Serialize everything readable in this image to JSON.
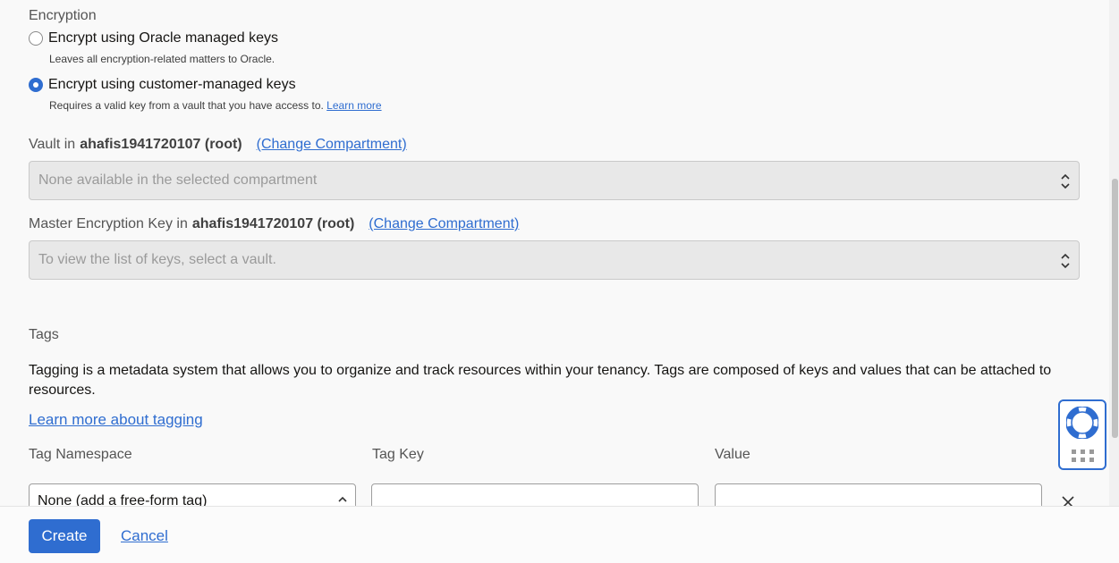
{
  "encryption": {
    "section_label": "Encryption",
    "options": [
      {
        "label": "Encrypt using Oracle managed keys",
        "help": "Leaves all encryption-related matters to Oracle.",
        "checked": false
      },
      {
        "label": "Encrypt using customer-managed keys",
        "help": "Requires a valid key from a vault that you have access to.",
        "help_link": "Learn more",
        "checked": true
      }
    ]
  },
  "vault": {
    "label": "Vault in",
    "compartment": "ahafis1941720107 (root)",
    "change_link": "(Change Compartment)",
    "placeholder": "None available in the selected compartment"
  },
  "master_key": {
    "label": "Master Encryption Key in",
    "compartment": "ahafis1941720107 (root)",
    "change_link": "(Change Compartment)",
    "placeholder": "To view the list of keys, select a vault."
  },
  "tags": {
    "section_label": "Tags",
    "description": "Tagging is a metadata system that allows you to organize and track resources within your tenancy. Tags are composed of keys and values that can be attached to resources.",
    "learn_more": "Learn more about tagging",
    "columns": {
      "namespace": "Tag Namespace",
      "key": "Tag Key",
      "value": "Value"
    },
    "row": {
      "namespace_value": "None (add a free-form tag)",
      "key_value": "",
      "value_value": ""
    }
  },
  "footer": {
    "create_label": "Create",
    "cancel_label": "Cancel"
  },
  "colors": {
    "accent": "#2f6dd0",
    "disabled_bg": "#e8e8e8"
  },
  "icons": {
    "help": "lifebuoy-icon",
    "apps": "grid-dots-icon",
    "remove": "close-icon"
  }
}
